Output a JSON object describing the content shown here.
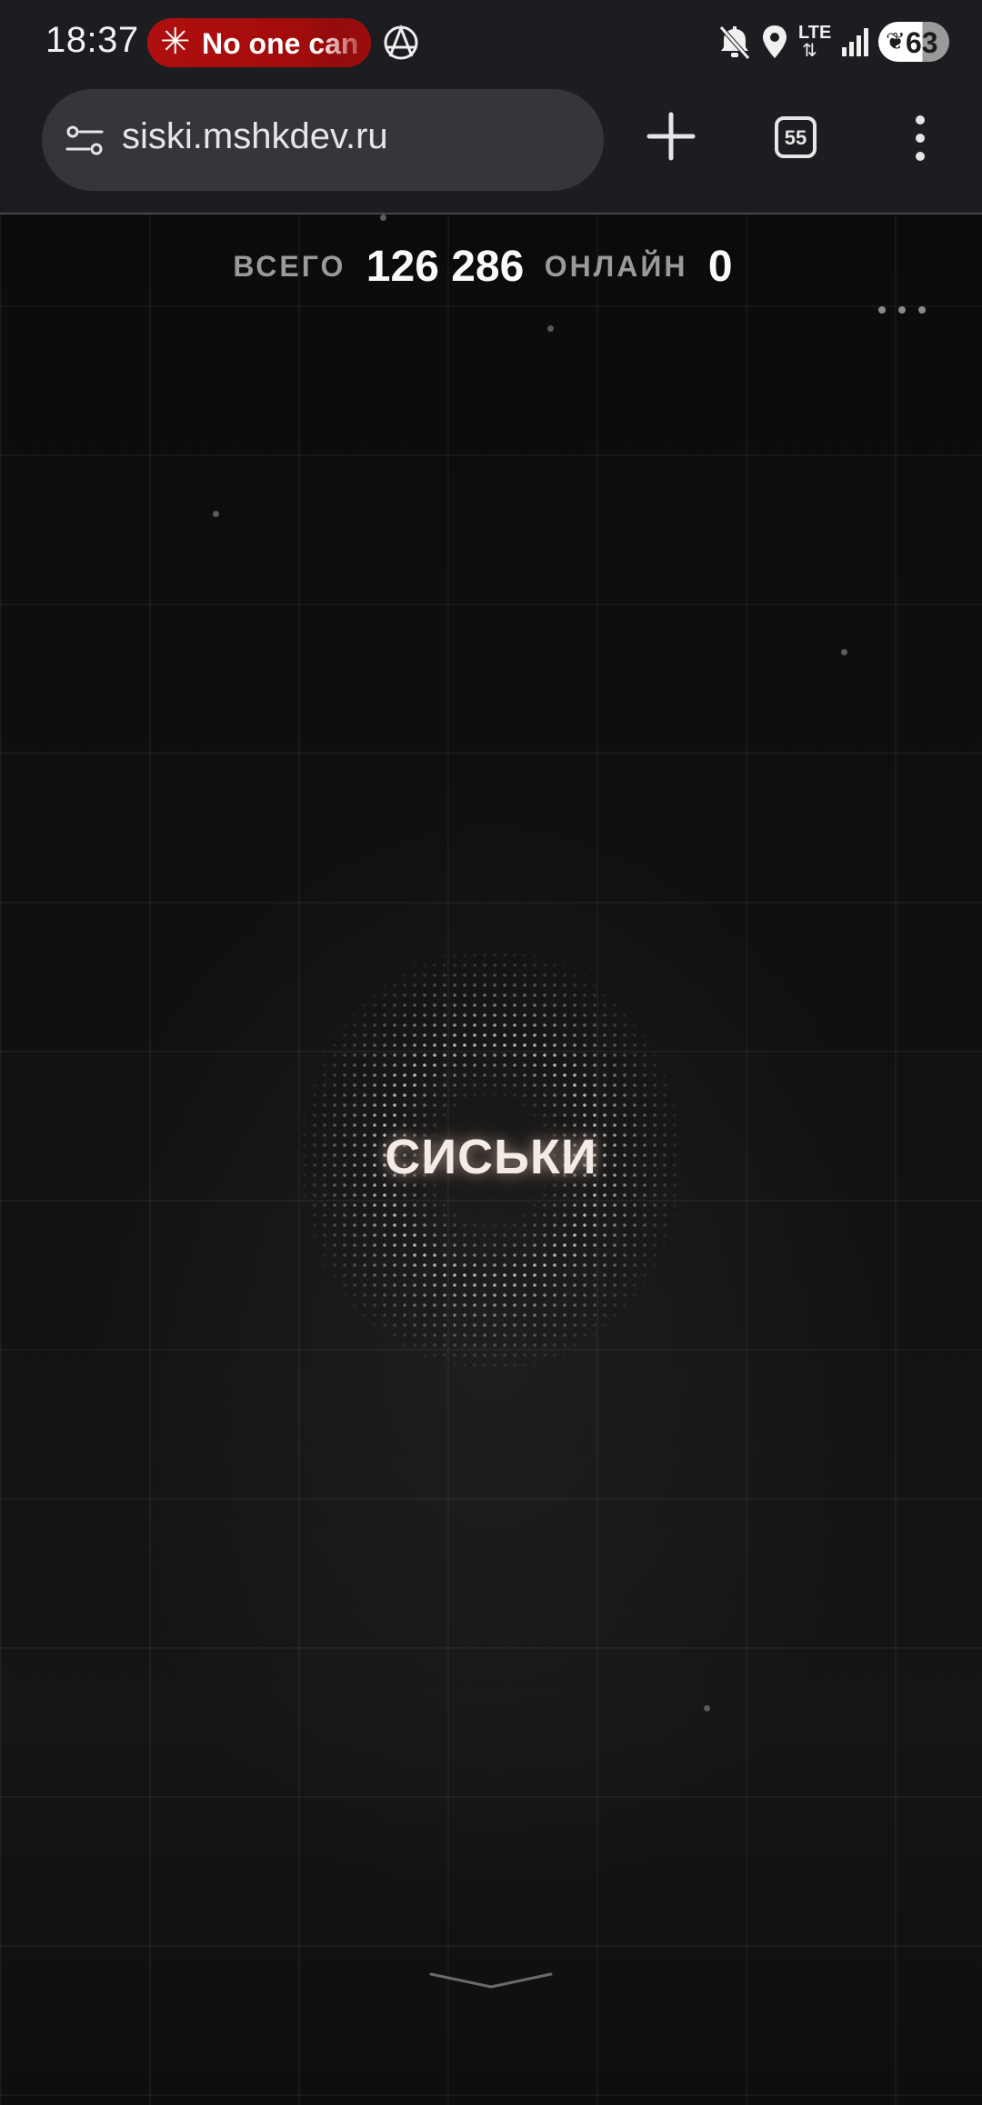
{
  "status_bar": {
    "time": "18:37",
    "notification_pill": {
      "icon": "sparkle-icon",
      "text": "No one can",
      "color": "#b00f0f"
    },
    "icons": [
      "anarchy-icon",
      "mute-icon",
      "location-icon",
      "lte-icon",
      "signal-icon"
    ],
    "lte_label": "LTE",
    "battery": {
      "icon": "leaf-icon",
      "percent": "63"
    }
  },
  "browser": {
    "url": "siski.mshkdev.ru",
    "tab_count": "55",
    "icons": [
      "site-settings-icon",
      "plus-icon",
      "tabs-icon",
      "more-vert-icon"
    ]
  },
  "page": {
    "stats": {
      "total_label": "ВСЕГО",
      "total_value": "126 286",
      "online_label": "ОНЛАЙН",
      "online_value": "0"
    },
    "center_button": {
      "label": "СИСЬКИ"
    },
    "icons": [
      "more-horiz-icon",
      "chevron-down-icon"
    ],
    "colors": {
      "background": "#0a0a0b",
      "accent_text": "#f4ebe4",
      "label_gray": "#9a9a9a"
    }
  }
}
